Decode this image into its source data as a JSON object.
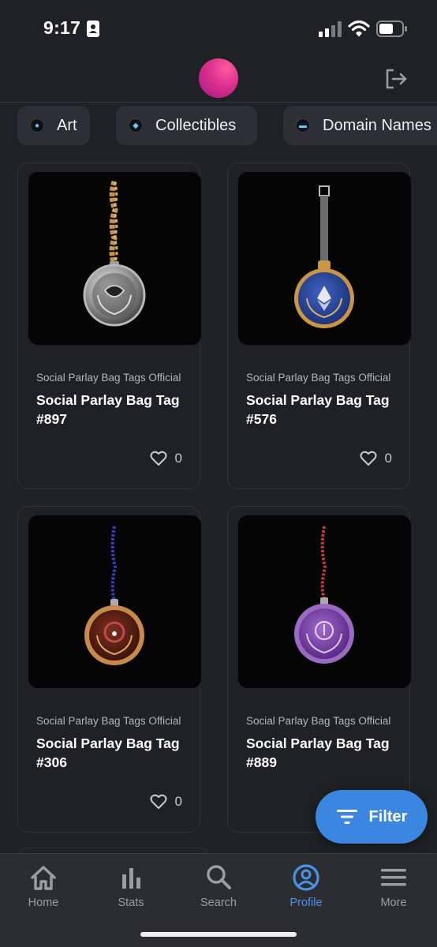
{
  "status_bar": {
    "time": "9:17"
  },
  "categories": [
    {
      "label": "Art",
      "icon": "art-icon"
    },
    {
      "label": "Collectibles",
      "icon": "collectibles-icon"
    },
    {
      "label": "Domain Names",
      "icon": "domain-names-icon"
    }
  ],
  "cards": [
    {
      "collection": "Social Parlay Bag Tags Official",
      "name": "Social Parlay Bag Tag #897",
      "likes": "0",
      "tag_color": "silver",
      "strap": "gold-chain"
    },
    {
      "collection": "Social Parlay Bag Tags Official",
      "name": "Social Parlay Bag Tag #576",
      "likes": "0",
      "tag_color": "blue",
      "strap": "gray-strap"
    },
    {
      "collection": "Social Parlay Bag Tags Official",
      "name": "Social Parlay Bag Tag #306",
      "likes": "0",
      "tag_color": "bronze",
      "strap": "blue-cord"
    },
    {
      "collection": "Social Parlay Bag Tags Official",
      "name": "Social Parlay Bag Tag #889",
      "likes": "0",
      "tag_color": "purple",
      "strap": "red-cord"
    }
  ],
  "filter": {
    "label": "Filter"
  },
  "tabs": [
    {
      "label": "Home",
      "icon": "home-icon"
    },
    {
      "label": "Stats",
      "icon": "stats-icon"
    },
    {
      "label": "Search",
      "icon": "search-icon"
    },
    {
      "label": "Profile",
      "icon": "profile-icon",
      "active": true
    },
    {
      "label": "More",
      "icon": "menu-icon"
    }
  ],
  "colors": {
    "accent": "#3a86e0",
    "background": "#1f2124",
    "active_tab": "#4b92ea"
  }
}
